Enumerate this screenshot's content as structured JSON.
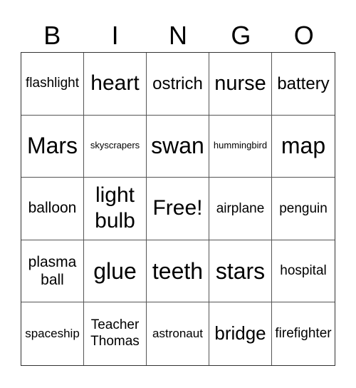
{
  "header": [
    "B",
    "I",
    "N",
    "G",
    "O"
  ],
  "cells": [
    [
      "flashlight",
      "heart",
      "ostrich",
      "nurse",
      "battery"
    ],
    [
      "Mars",
      "skyscrapers",
      "swan",
      "hummingbird",
      "map"
    ],
    [
      "balloon",
      "light bulb",
      "Free!",
      "airplane",
      "penguin"
    ],
    [
      "plasma ball",
      "glue",
      "teeth",
      "stars",
      "hospital"
    ],
    [
      "spaceship",
      "Teacher Thomas",
      "astronaut",
      "bridge",
      "firefighter"
    ]
  ]
}
